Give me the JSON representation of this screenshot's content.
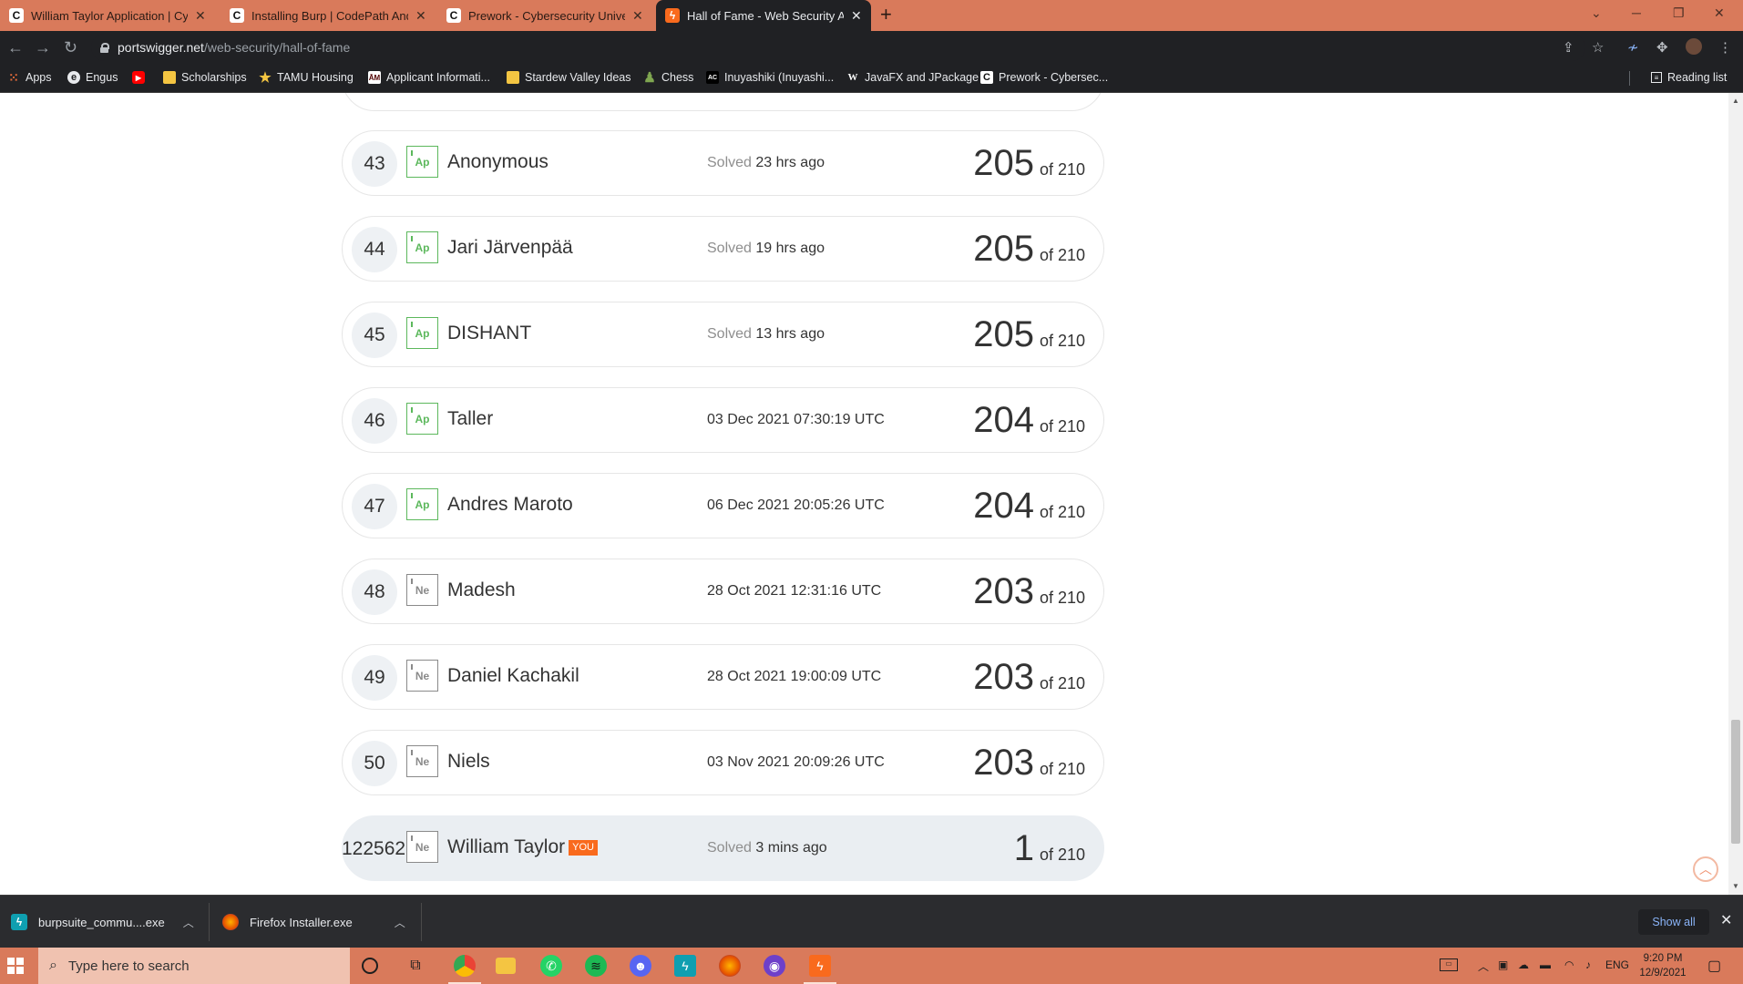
{
  "tabs": [
    {
      "title": "William Taylor Application | Cybe",
      "favicon": "C",
      "active": false
    },
    {
      "title": "Installing Burp | CodePath Andro",
      "favicon": "C",
      "active": false
    },
    {
      "title": "Prework - Cybersecurity Universit",
      "favicon": "C",
      "active": false
    },
    {
      "title": "Hall of Fame - Web Security Acac",
      "favicon": "burp-icon",
      "active": true
    }
  ],
  "toolbar": {
    "url_host": "portswigger.net",
    "url_path": "/web-security/hall-of-fame"
  },
  "bookmarks": [
    {
      "label": "Apps",
      "icon": "apps-grid-icon"
    },
    {
      "label": "Engus",
      "icon": "engus-icon"
    },
    {
      "label": "",
      "icon": "youtube-icon"
    },
    {
      "label": "Scholarships",
      "icon": "folder-icon"
    },
    {
      "label": "TAMU Housing",
      "icon": "star-icon"
    },
    {
      "label": "Applicant Informati...",
      "icon": "tamu-icon"
    },
    {
      "label": "Stardew Valley Ideas",
      "icon": "folder-icon"
    },
    {
      "label": "Chess",
      "icon": "chess-pawn-icon"
    },
    {
      "label": "Inuyashiki (Inuyashi...",
      "icon": "anime-icon"
    },
    {
      "label": "JavaFX and JPackage",
      "icon": "w-icon"
    },
    {
      "label": "Prework - Cybersec...",
      "icon": "codepath-icon"
    }
  ],
  "reading_list": "Reading list",
  "leaderboard": [
    {
      "rank": "43",
      "badge": "Ap",
      "level": "apprentice",
      "name": "Anonymous",
      "solved_prefix": "Solved",
      "solved_time": "23 hrs ago",
      "score": "205",
      "total": "of 210"
    },
    {
      "rank": "44",
      "badge": "Ap",
      "level": "apprentice",
      "name": "Jari Järvenpää",
      "solved_prefix": "Solved",
      "solved_time": "19 hrs ago",
      "score": "205",
      "total": "of 210"
    },
    {
      "rank": "45",
      "badge": "Ap",
      "level": "apprentice",
      "name": "DISHANT",
      "solved_prefix": "Solved",
      "solved_time": "13 hrs ago",
      "score": "205",
      "total": "of 210"
    },
    {
      "rank": "46",
      "badge": "Ap",
      "level": "apprentice",
      "name": "Taller",
      "solved_prefix": "",
      "solved_time": "03 Dec 2021 07:30:19 UTC",
      "score": "204",
      "total": "of 210"
    },
    {
      "rank": "47",
      "badge": "Ap",
      "level": "apprentice",
      "name": "Andres Maroto",
      "solved_prefix": "",
      "solved_time": "06 Dec 2021 20:05:26 UTC",
      "score": "204",
      "total": "of 210"
    },
    {
      "rank": "48",
      "badge": "Ne",
      "level": "newcomer",
      "name": "Madesh",
      "solved_prefix": "",
      "solved_time": "28 Oct 2021 12:31:16 UTC",
      "score": "203",
      "total": "of 210"
    },
    {
      "rank": "49",
      "badge": "Ne",
      "level": "newcomer",
      "name": "Daniel Kachakil",
      "solved_prefix": "",
      "solved_time": "28 Oct 2021 19:00:09 UTC",
      "score": "203",
      "total": "of 210"
    },
    {
      "rank": "50",
      "badge": "Ne",
      "level": "newcomer",
      "name": "Niels",
      "solved_prefix": "",
      "solved_time": "03 Nov 2021 20:09:26 UTC",
      "score": "203",
      "total": "of 210"
    }
  ],
  "current_user": {
    "rank": "122562",
    "badge": "Ne",
    "level": "newcomer",
    "name": "William Taylor",
    "you_label": "YOU",
    "solved_prefix": "Solved",
    "solved_time": "3 mins ago",
    "score": "1",
    "total": "of 210"
  },
  "downloads": [
    {
      "filename": "burpsuite_commu....exe",
      "icon": "burp-icon"
    },
    {
      "filename": "Firefox Installer.exe",
      "icon": "firefox-icon"
    }
  ],
  "downloads_show_all": "Show all",
  "taskbar": {
    "search_placeholder": "Type here to search",
    "language": "ENG",
    "time": "9:20 PM",
    "date": "12/9/2021"
  },
  "colors": {
    "accent_orange": "#f96a1d",
    "apprentice_green": "#5cb85c",
    "newcomer_gray": "#8a8a8a",
    "chrome_dark": "#202124",
    "theme_salmon": "#d97a5b"
  }
}
